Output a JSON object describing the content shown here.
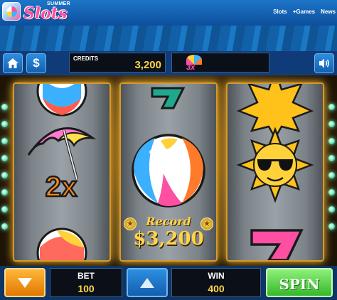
{
  "app": {
    "brand_top": "SUMMER",
    "brand_main": "Slots"
  },
  "nav": {
    "slots": "Slots",
    "more_games": "+Games",
    "news": "News"
  },
  "header": {
    "credits_label": "CREDITS",
    "credits_value": "3,200",
    "multiplier": "3x"
  },
  "reels": {
    "reel1": [
      "beach-ball",
      "umbrella-2x",
      "beach-ball"
    ],
    "reel2": [
      "seven",
      "beach-ball"
    ],
    "reel3": [
      "sun",
      "sun-with-sunglasses",
      "seven"
    ],
    "umbrella_multiplier": "2x"
  },
  "record": {
    "label": "Record",
    "value": "$3,200"
  },
  "controls": {
    "bet_label": "BET",
    "bet_value": "100",
    "win_label": "WIN",
    "win_value": "400",
    "spin_label": "SPIN"
  },
  "colors": {
    "accent_gold": "#ffd34a",
    "brand_pink": "#ff4fa3",
    "spin_green": "#36b82a",
    "frame_blue": "#0e3566"
  }
}
